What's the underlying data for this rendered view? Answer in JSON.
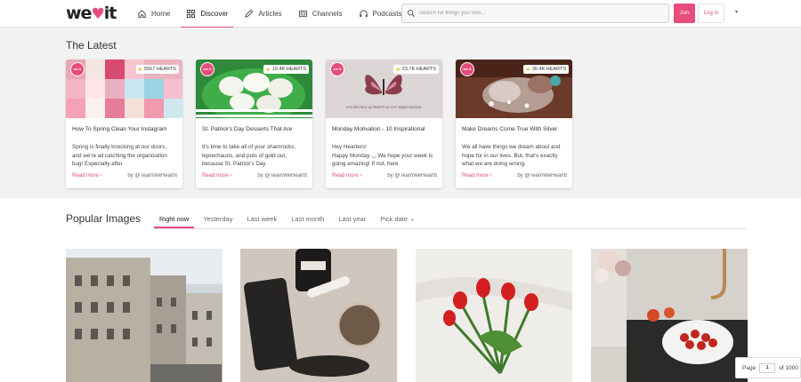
{
  "header": {
    "logo_text": "we",
    "logo_suffix": "it",
    "nav": [
      {
        "label": "Home"
      },
      {
        "label": "Discover"
      },
      {
        "label": "Articles"
      },
      {
        "label": "Channels"
      },
      {
        "label": "Podcasts"
      }
    ],
    "search_placeholder": "Search for things you love...",
    "join_label": "Join",
    "login_label": "Log in",
    "more_caret": "▾"
  },
  "latest": {
    "title": "The Latest",
    "cards": [
      {
        "hearts": "5567 HEARTS",
        "title": "How To Spring Clean Your Instagram",
        "text": "Spring is finally knocking at our doors, and we're all catching the organization bug! Especially after",
        "read_more": "Read more ›",
        "byline": "by @TeamWeHeartIt"
      },
      {
        "hearts": "10.4K HEARTS",
        "title": "St. Patrick's Day Desserts That Are",
        "text": "It's time to take all of your shamrocks, leprechauns, and pots of gold out, because St. Patrick's Day",
        "read_more": "Read more ›",
        "byline": "by @TeamWeHeartIt"
      },
      {
        "hearts": "23.7K HEARTS",
        "title": "Monday Motivation - 10 Inspirational",
        "text": "Hey Hearters!\nHappy Monday ◡ We hope your week is going amazing! If not, here",
        "read_more": "Read more ›",
        "byline": "by @TeamWeHeartIt",
        "image_caption": "YOU'RE ONLY AS PRETTY AS YOU TREAT PEOPLE."
      },
      {
        "hearts": "30.4K HEARTS",
        "title": "Make Dreams Come True With Silver",
        "text": "We all have things we dream about and hope for in our lives. But, that's exactly what we are doing wrong.",
        "read_more": "Read more ›",
        "byline": "by @TeamWeHeartIt"
      }
    ],
    "badge_text": "we it"
  },
  "popular": {
    "title": "Popular Images",
    "tabs": [
      {
        "label": "Right now"
      },
      {
        "label": "Yesterday"
      },
      {
        "label": "Last week"
      },
      {
        "label": "Last month"
      },
      {
        "label": "Last year"
      },
      {
        "label": "Pick date"
      }
    ],
    "caret": "▾"
  },
  "pager": {
    "label": "Page",
    "value": "1",
    "of_label": "of 1000"
  },
  "colors": {
    "accent": "#e74c7a",
    "star": "#f5b301"
  }
}
